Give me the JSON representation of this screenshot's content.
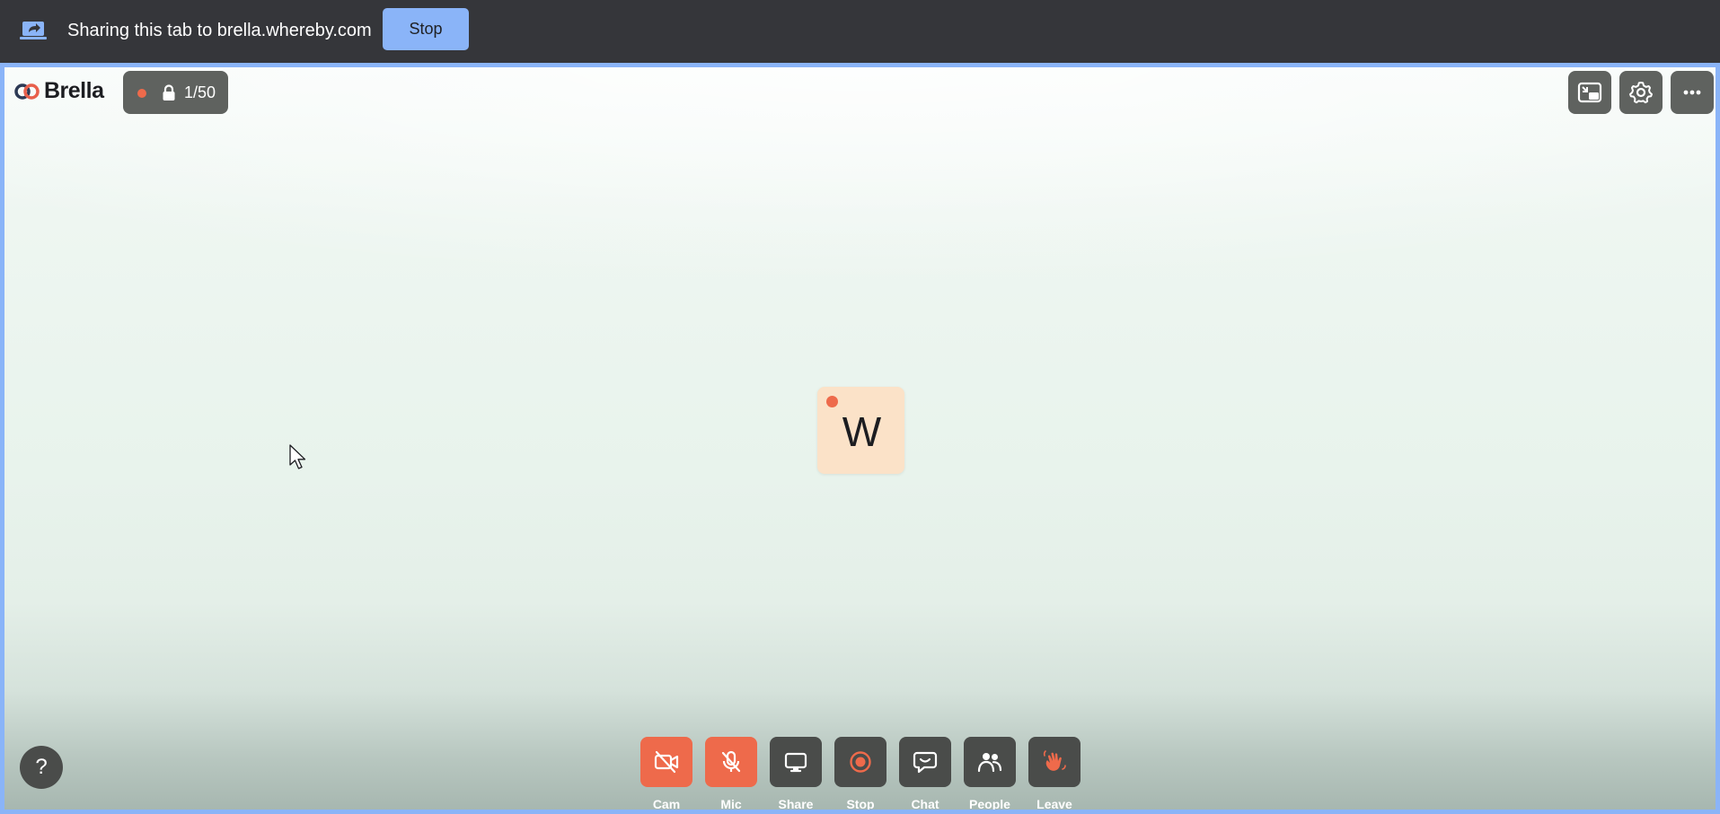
{
  "share_bar": {
    "text": "Sharing this tab to brella.whereby.com",
    "stop_label": "Stop"
  },
  "room": {
    "brand": "Brella",
    "participant_count": "1/50",
    "avatar_initial": "W",
    "help_label": "?"
  },
  "toolbar": {
    "cam_label": "Cam",
    "mic_label": "Mic",
    "share_label": "Share",
    "stop_label": "Stop",
    "chat_label": "Chat",
    "people_label": "People",
    "leave_label": "Leave"
  },
  "icons": {
    "share_tab": "screen-share-icon",
    "lock": "lock-icon",
    "pip": "picture-in-picture-icon",
    "settings": "gear-icon",
    "more": "more-horizontal-icon",
    "cam": "camera-off-icon",
    "mic": "mic-off-icon",
    "share": "monitor-icon",
    "stop": "record-stop-icon",
    "chat": "chat-bubble-icon",
    "people": "people-icon",
    "leave": "waving-hand-icon"
  },
  "colors": {
    "chrome_bar": "#35363a",
    "stop_button": "#8ab4f8",
    "accent_red": "#ee6a4b",
    "control_dark": "#4a4c4a",
    "avatar_bg": "#fbe2c8"
  }
}
